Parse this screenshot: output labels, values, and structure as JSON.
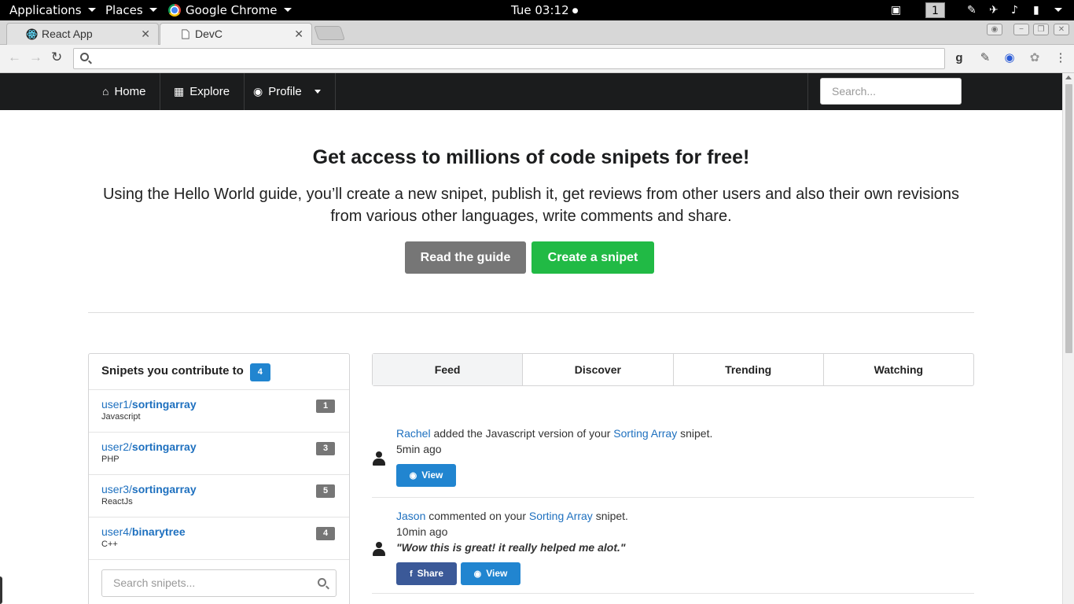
{
  "os": {
    "applications": "Applications",
    "places": "Places",
    "browser_name": "Google Chrome",
    "clock": "Tue 03:12",
    "workspace": "1"
  },
  "browser": {
    "tabs": [
      {
        "title": "React App",
        "icon": "react-icon"
      },
      {
        "title": "DevC",
        "icon": "page-icon"
      }
    ],
    "url": ""
  },
  "nav": {
    "home": "Home",
    "explore": "Explore",
    "profile": "Profile",
    "search_placeholder": "Search..."
  },
  "hero": {
    "title": "Get access to millions of code snipets for free!",
    "text": "Using the Hello World guide, you’ll create a new snipet, publish it, get reviews from other users and also their own revisions from various other languages, write comments and share.",
    "read_guide": "Read the guide",
    "create": "Create a snipet"
  },
  "contrib": {
    "title": "Snipets you contribute to",
    "count": "4",
    "items": [
      {
        "user": "user1/",
        "repo": "sortingarray",
        "lang": "Javascript",
        "count": "1"
      },
      {
        "user": "user2/",
        "repo": "sortingarray",
        "lang": "PHP",
        "count": "3"
      },
      {
        "user": "user3/",
        "repo": "sortingarray",
        "lang": "ReactJs",
        "count": "5"
      },
      {
        "user": "user4/",
        "repo": "binarytree",
        "lang": "C++",
        "count": "4"
      }
    ],
    "search_placeholder": "Search snipets..."
  },
  "tabs": [
    "Feed",
    "Discover",
    "Trending",
    "Watching"
  ],
  "feed": [
    {
      "user": "Rachel",
      "action": " added the Javascript version of your ",
      "target": "Sorting Array",
      "suffix": " snipet.",
      "time": "5min ago",
      "view": "View"
    },
    {
      "user": "Jason",
      "action": " commented on your ",
      "target": "Sorting Array",
      "suffix": " snipet.",
      "time": "10min ago",
      "quote": "\"Wow this is great! it really helped me alot.\"",
      "share": "Share",
      "view": "View"
    }
  ],
  "colors": {
    "nav_bg": "#1b1c1d",
    "primary": "#2185d0",
    "green": "#21ba45",
    "grey": "#767676",
    "facebook": "#3b5998",
    "link": "#1e70bf"
  }
}
